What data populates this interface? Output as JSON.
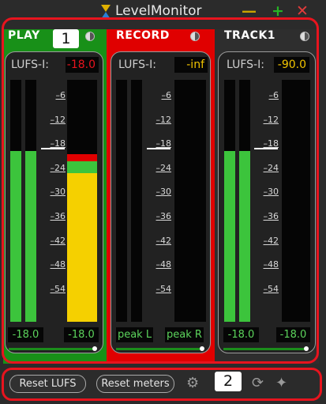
{
  "window": {
    "title": "LevelMonitor"
  },
  "panels": [
    {
      "title": "PLAY",
      "lufs_label": "LUFS-I:",
      "lufs_value": "-18.0",
      "lufs_color": "#e8141e",
      "left_value": "-18.0",
      "right_value": "-18.0",
      "left_level_db": -18,
      "right_level_db": -18,
      "right_peak_db": -18,
      "bg": "#189018",
      "marker_db": -18
    },
    {
      "title": "RECORD",
      "lufs_label": "LUFS-I:",
      "lufs_value": "-inf",
      "lufs_color": "#f2c400",
      "left_value": "peak L",
      "right_value": "peak R",
      "bg": "#e00000",
      "marker_db": -18
    },
    {
      "title": "TRACK1",
      "lufs_label": "LUFS-I:",
      "lufs_value": "-90.0",
      "lufs_color": "#f2c400",
      "left_value": "-18.0",
      "right_value": "-18.0",
      "left_level_db": -18,
      "right_level_db": -18,
      "bg": "#2e2e2e",
      "marker_db": -18
    }
  ],
  "scale_ticks": [
    "-6",
    "-12",
    "-18",
    "-24",
    "-30",
    "-36",
    "-42",
    "-48",
    "-54"
  ],
  "footer": {
    "reset_lufs": "Reset LUFS",
    "reset_meters": "Reset meters"
  },
  "annotations": [
    "1",
    "2"
  ],
  "colors": {
    "accent_red": "#e8141e",
    "meter_green": "#3cc43c",
    "meter_yellow": "#f5d000",
    "meter_red": "#e00000"
  }
}
